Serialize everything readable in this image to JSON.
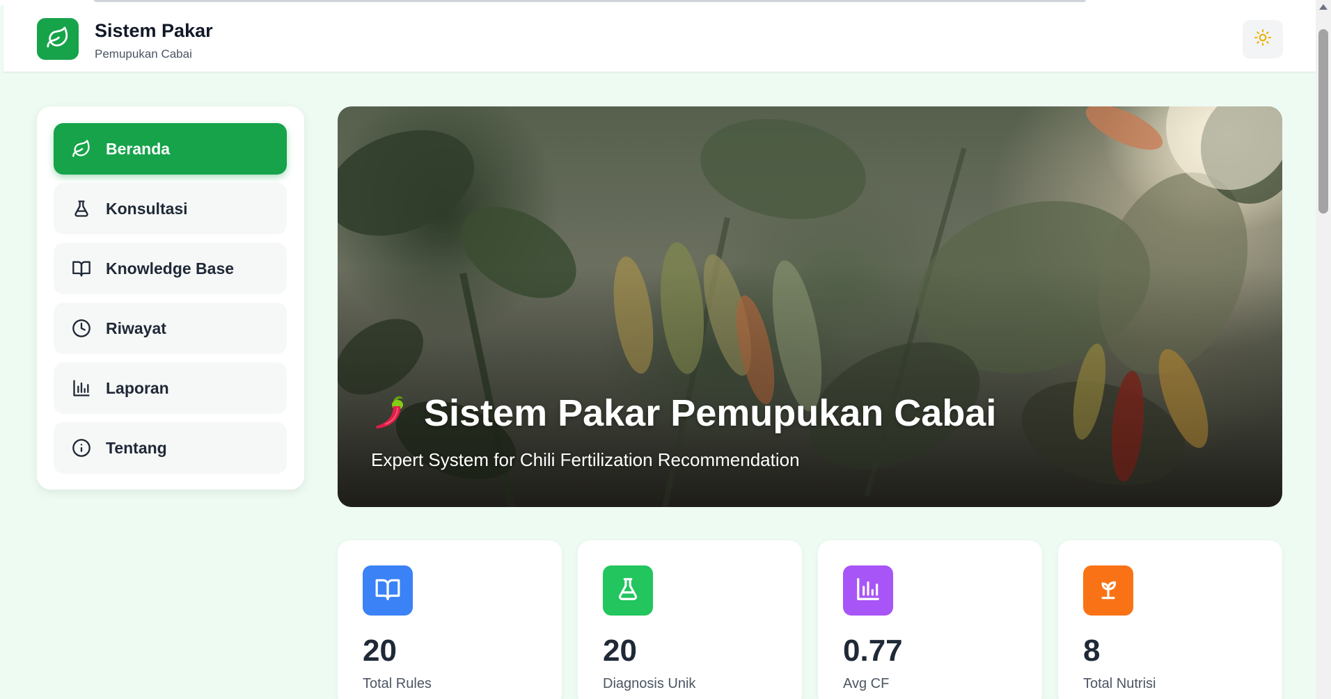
{
  "header": {
    "title": "Sistem Pakar",
    "subtitle": "Pemupukan Cabai",
    "logo_icon": "leaf-icon",
    "theme_toggle_icon": "sun-icon",
    "brand_color": "#16a34a"
  },
  "sidebar": {
    "items": [
      {
        "label": "Beranda",
        "icon": "leaf-icon",
        "active": true
      },
      {
        "label": "Konsultasi",
        "icon": "flask-icon",
        "active": false
      },
      {
        "label": "Knowledge Base",
        "icon": "book-icon",
        "active": false
      },
      {
        "label": "Riwayat",
        "icon": "clock-icon",
        "active": false
      },
      {
        "label": "Laporan",
        "icon": "bar-chart-icon",
        "active": false
      },
      {
        "label": "Tentang",
        "icon": "info-icon",
        "active": false
      }
    ]
  },
  "hero": {
    "emoji": "🌶️",
    "title": "Sistem Pakar Pemupukan Cabai",
    "subtitle": "Expert System for Chili Fertilization Recommendation"
  },
  "stats": [
    {
      "value": "20",
      "label": "Total Rules",
      "icon": "book-icon",
      "color": "#3b82f6"
    },
    {
      "value": "20",
      "label": "Diagnosis Unik",
      "icon": "flask-icon",
      "color": "#22c55e"
    },
    {
      "value": "0.77",
      "label": "Avg CF",
      "icon": "bar-chart-icon",
      "color": "#a855f7"
    },
    {
      "value": "8",
      "label": "Total Nutrisi",
      "icon": "sprout-icon",
      "color": "#f97316"
    }
  ]
}
